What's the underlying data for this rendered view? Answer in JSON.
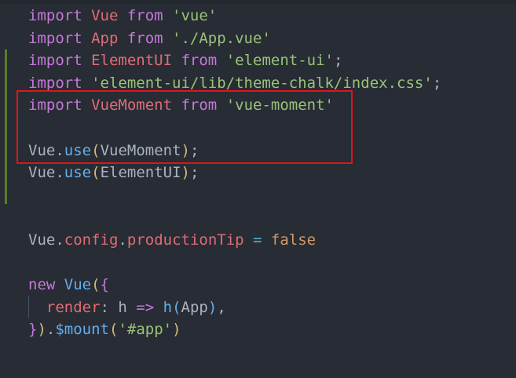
{
  "editor": {
    "lines": [
      {
        "tokens": [
          {
            "t": "import",
            "c": "kw"
          },
          {
            "t": " Vue ",
            "c": "id"
          },
          {
            "t": "from",
            "c": "kw"
          },
          {
            "t": " 'vue'",
            "c": "str"
          }
        ]
      },
      {
        "tokens": [
          {
            "t": "import",
            "c": "kw"
          },
          {
            "t": " App ",
            "c": "id"
          },
          {
            "t": "from",
            "c": "kw"
          },
          {
            "t": " './App.vue'",
            "c": "str"
          }
        ]
      },
      {
        "tokens": [
          {
            "t": "import",
            "c": "kw"
          },
          {
            "t": " ElementUI ",
            "c": "id"
          },
          {
            "t": "from",
            "c": "kw"
          },
          {
            "t": " 'element-ui'",
            "c": "str"
          },
          {
            "t": ";",
            "c": "plain"
          }
        ]
      },
      {
        "tokens": [
          {
            "t": "import",
            "c": "kw"
          },
          {
            "t": " 'element-ui/lib/theme-chalk/index.css'",
            "c": "str"
          },
          {
            "t": ";",
            "c": "plain"
          }
        ]
      },
      {
        "tokens": [
          {
            "t": "import",
            "c": "kw"
          },
          {
            "t": " VueMoment ",
            "c": "id"
          },
          {
            "t": "from",
            "c": "kw"
          },
          {
            "t": " 'vue-moment'",
            "c": "str"
          }
        ]
      },
      {
        "tokens": []
      },
      {
        "tokens": [
          {
            "t": "Vue",
            "c": "plain"
          },
          {
            "t": ".",
            "c": "plain"
          },
          {
            "t": "use",
            "c": "fn"
          },
          {
            "t": "(",
            "c": "paren"
          },
          {
            "t": "VueMoment",
            "c": "plain"
          },
          {
            "t": ")",
            "c": "paren"
          },
          {
            "t": ";",
            "c": "plain"
          }
        ]
      },
      {
        "tokens": [
          {
            "t": "Vue",
            "c": "plain"
          },
          {
            "t": ".",
            "c": "plain"
          },
          {
            "t": "use",
            "c": "fn"
          },
          {
            "t": "(",
            "c": "paren"
          },
          {
            "t": "ElementUI",
            "c": "plain"
          },
          {
            "t": ")",
            "c": "paren"
          },
          {
            "t": ";",
            "c": "plain"
          }
        ]
      },
      {
        "tokens": []
      },
      {
        "tokens": []
      },
      {
        "tokens": [
          {
            "t": "Vue",
            "c": "plain"
          },
          {
            "t": ".",
            "c": "plain"
          },
          {
            "t": "config",
            "c": "prop"
          },
          {
            "t": ".",
            "c": "plain"
          },
          {
            "t": "productionTip",
            "c": "prop"
          },
          {
            "t": " = ",
            "c": "op"
          },
          {
            "t": "false",
            "c": "bool"
          }
        ]
      },
      {
        "tokens": []
      },
      {
        "tokens": [
          {
            "t": "new",
            "c": "kw"
          },
          {
            "t": " Vue",
            "c": "fn"
          },
          {
            "t": "(",
            "c": "paren"
          },
          {
            "t": "{",
            "c": "paren2"
          }
        ]
      },
      {
        "tokens": [
          {
            "t": "  render",
            "c": "prop"
          },
          {
            "t": ": ",
            "c": "plain"
          },
          {
            "t": "h",
            "c": "plain"
          },
          {
            "t": " => ",
            "c": "kw"
          },
          {
            "t": "h",
            "c": "fn"
          },
          {
            "t": "(",
            "c": "brace"
          },
          {
            "t": "App",
            "c": "plain"
          },
          {
            "t": ")",
            "c": "brace"
          },
          {
            "t": ",",
            "c": "plain"
          }
        ]
      },
      {
        "tokens": [
          {
            "t": "}",
            "c": "paren2"
          },
          {
            "t": ")",
            "c": "paren"
          },
          {
            "t": ".",
            "c": "plain"
          },
          {
            "t": "$mount",
            "c": "fn"
          },
          {
            "t": "(",
            "c": "paren"
          },
          {
            "t": "'#app'",
            "c": "str"
          },
          {
            "t": ")",
            "c": "paren"
          }
        ]
      }
    ]
  },
  "annotation": {
    "highlight_color": "#e0141b"
  },
  "colors": {
    "background": "#282c34",
    "gutter_modified": "#5a7d2a"
  }
}
